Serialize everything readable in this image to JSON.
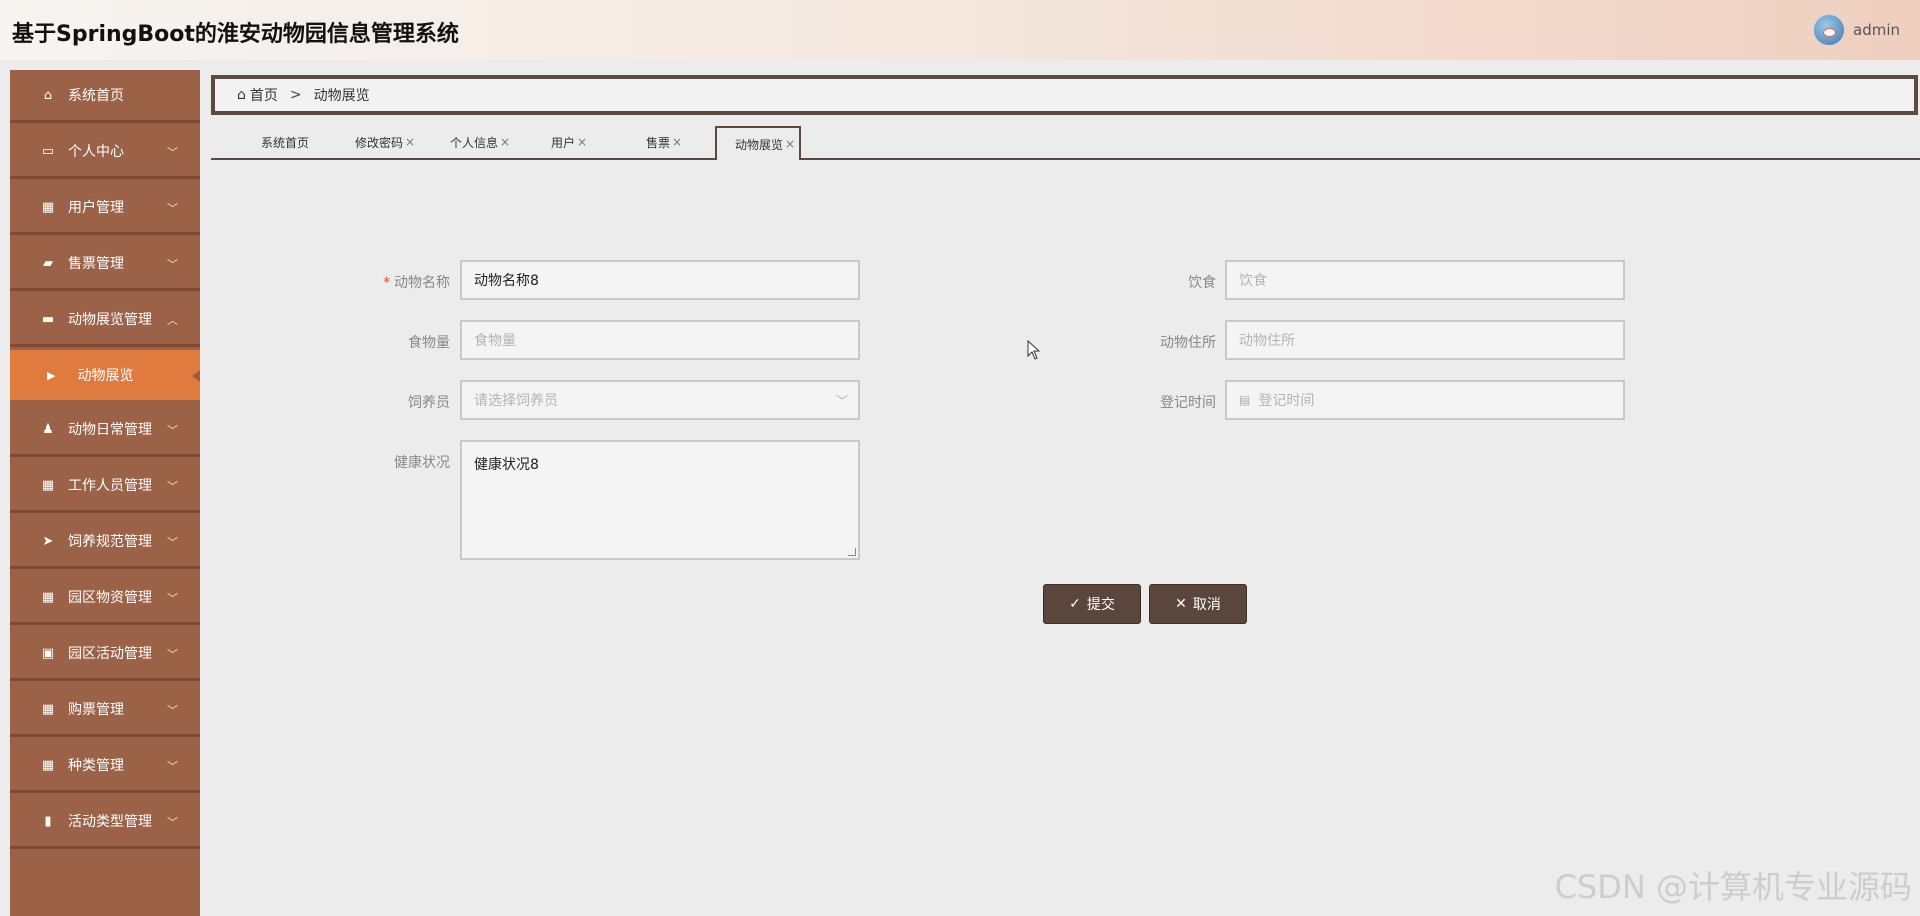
{
  "header": {
    "title": "基于SpringBoot的淮安动物园信息管理系统",
    "username": "admin"
  },
  "sidebar": {
    "items": [
      {
        "label": "系统首页",
        "icon": "home-icon",
        "has_children": false
      },
      {
        "label": "个人中心",
        "icon": "card-icon",
        "has_children": true
      },
      {
        "label": "用户管理",
        "icon": "grid-icon",
        "has_children": true
      },
      {
        "label": "售票管理",
        "icon": "ticket-icon",
        "has_children": true
      },
      {
        "label": "动物展览管理",
        "icon": "ticket-icon",
        "has_children": true,
        "expanded": true
      },
      {
        "label": "动物日常管理",
        "icon": "person-icon",
        "has_children": true
      },
      {
        "label": "工作人员管理",
        "icon": "grid-icon",
        "has_children": true
      },
      {
        "label": "饲养规范管理",
        "icon": "send-icon",
        "has_children": true
      },
      {
        "label": "园区物资管理",
        "icon": "grid-icon",
        "has_children": true
      },
      {
        "label": "园区活动管理",
        "icon": "clipboard-icon",
        "has_children": true
      },
      {
        "label": "购票管理",
        "icon": "grid-icon",
        "has_children": true
      },
      {
        "label": "种类管理",
        "icon": "grid-icon",
        "has_children": true
      },
      {
        "label": "活动类型管理",
        "icon": "bar-chart-icon",
        "has_children": true
      }
    ],
    "active_sub": "动物展览"
  },
  "breadcrumb": {
    "home": "首页",
    "separator": ">",
    "current": "动物展览"
  },
  "tabs": [
    {
      "label": "系统首页",
      "closable": false
    },
    {
      "label": "修改密码",
      "closable": true
    },
    {
      "label": "个人信息",
      "closable": true
    },
    {
      "label": "用户",
      "closable": true
    },
    {
      "label": "售票",
      "closable": true
    },
    {
      "label": "动物展览",
      "closable": true,
      "active": true
    }
  ],
  "form": {
    "animal_name": {
      "label": "动物名称",
      "value": "动物名称8",
      "required": true
    },
    "diet": {
      "label": "饮食",
      "placeholder": "饮食"
    },
    "food_amount": {
      "label": "食物量",
      "placeholder": "食物量"
    },
    "habitat": {
      "label": "动物住所",
      "placeholder": "动物住所"
    },
    "keeper": {
      "label": "饲养员",
      "placeholder": "请选择饲养员"
    },
    "register_time": {
      "label": "登记时间",
      "placeholder": "登记时间"
    },
    "health": {
      "label": "健康状况",
      "value": "健康状况8"
    }
  },
  "buttons": {
    "submit": "提交",
    "cancel": "取消"
  },
  "watermark": "CSDN @计算机专业源码",
  "colors": {
    "sidebar": "#9b6248",
    "sidebar_active": "#e07b40",
    "button": "#5a463d",
    "frame": "#5c4a40"
  }
}
